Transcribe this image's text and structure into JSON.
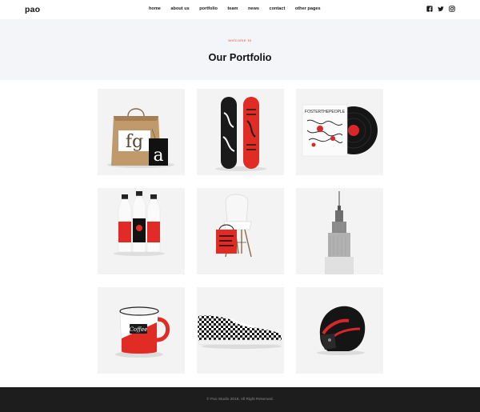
{
  "brand": {
    "logo": "pao"
  },
  "nav": {
    "items": [
      "home",
      "about us",
      "portfolio",
      "team",
      "news",
      "contact",
      "other pages"
    ]
  },
  "social": [
    "facebook-icon",
    "twitter-icon",
    "instagram-icon"
  ],
  "hero": {
    "kicker": "welcome to",
    "title": "Our Portfolio"
  },
  "portfolio": {
    "items": [
      {
        "icon": "paper-bag-mockup-image",
        "text": [
          "fg",
          "a"
        ]
      },
      {
        "icon": "skateboard-mockup-image",
        "text": []
      },
      {
        "icon": "vinyl-record-mockup-image",
        "text": [
          "FOSTERTHEPEOPLE"
        ]
      },
      {
        "icon": "milk-bottles-mockup-image",
        "text": []
      },
      {
        "icon": "chair-and-bag-image",
        "text": []
      },
      {
        "icon": "skyscraper-image",
        "text": []
      },
      {
        "icon": "enamel-mug-mockup-image",
        "text": [
          "Coffee"
        ]
      },
      {
        "icon": "checkered-shoe-image",
        "text": []
      },
      {
        "icon": "motorcycle-helmet-image",
        "text": []
      }
    ]
  },
  "footer": {
    "copyright": "© Pao Studio 2018, All Right Reserved."
  },
  "colors": {
    "accent": "#e2593a",
    "hero_bg": "#f4f5f9",
    "footer_bg": "#1d1d1d",
    "card_bg": "#f3f3f3"
  }
}
